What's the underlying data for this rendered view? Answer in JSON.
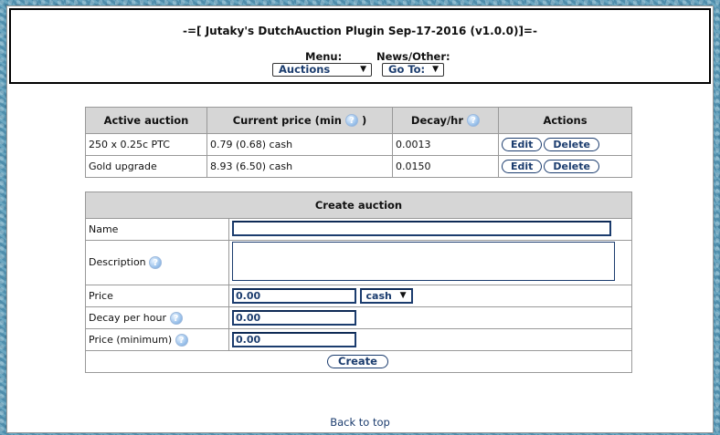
{
  "header": {
    "title": "-=[ Jutaky's DutchAuction Plugin Sep-17-2016 (v1.0.0)]=-",
    "menu_label": "Menu:",
    "menu_selected": "Auctions",
    "news_label": "News/Other:",
    "news_selected": "Go To:"
  },
  "active_auctions": {
    "columns": [
      "Active auction",
      "Current price (min",
      ")",
      "Decay/hr",
      "Actions"
    ],
    "rows": [
      {
        "name": "250 x 0.25c PTC",
        "price": "0.79 (0.68) cash",
        "decay": "0.0013"
      },
      {
        "name": "Gold upgrade",
        "price": "8.93 (6.50) cash",
        "decay": "0.0150"
      }
    ],
    "edit_label": "Edit",
    "delete_label": "Delete"
  },
  "create_auction": {
    "heading": "Create auction",
    "name_label": "Name",
    "description_label": "Description",
    "price_label": "Price",
    "price_value": "0.00",
    "currency_selected": "cash",
    "decay_label": "Decay per hour",
    "decay_value": "0.00",
    "min_label": "Price (minimum)",
    "min_value": "0.00",
    "create_label": "Create"
  },
  "footer": {
    "back_to_top": "Back to top"
  },
  "icons": {
    "help": "?",
    "dropdown_arrow": "▼"
  },
  "colors": {
    "link_text": "#1b3c6e",
    "table_header_bg": "#d6d6d6"
  }
}
